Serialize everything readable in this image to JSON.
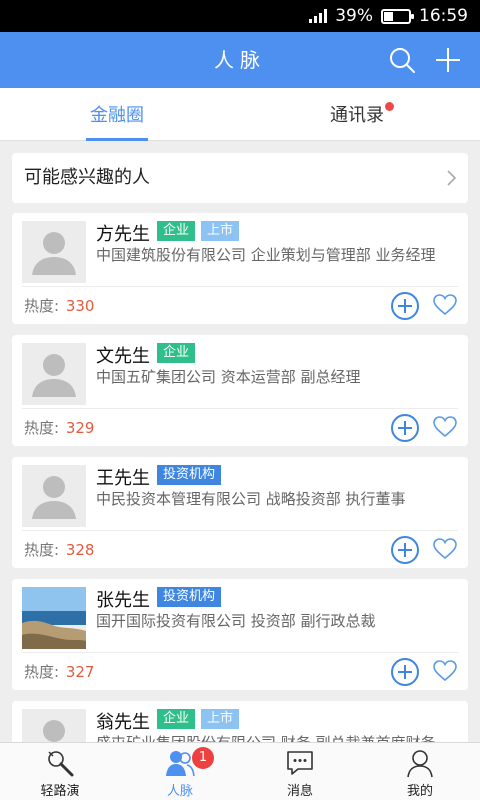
{
  "status_bar": {
    "battery": "39%",
    "battery_level": 0.39,
    "time": "16:59"
  },
  "app_bar": {
    "title": "人脉"
  },
  "tabs": [
    {
      "label": "金融圈",
      "active": true
    },
    {
      "label": "通讯录",
      "has_dot": true
    }
  ],
  "interest_row": {
    "label": "可能感兴趣的人"
  },
  "heat_label": "热度:",
  "tag_labels": {
    "company": "企业",
    "listed": "上市",
    "invest": "投资机构"
  },
  "people": [
    {
      "name": "方先生",
      "description": "中国建筑股份有限公司 企业策划与管理部 业务经理",
      "heat": "330"
    },
    {
      "name": "文先生",
      "description": "中国五矿集团公司 资本运营部 副总经理",
      "heat": "329"
    },
    {
      "name": "王先生",
      "description": "中民投资本管理有限公司 战略投资部 执行董事",
      "heat": "328"
    },
    {
      "name": "张先生",
      "description": "国开国际投资有限公司 投资部 副行政总裁",
      "heat": "327"
    },
    {
      "name": "翁先生",
      "description": "盛屯矿业集团股份有限公司 财务 副总裁兼首席财务",
      "heat": ""
    }
  ],
  "bottom_nav": [
    {
      "label": "轻路演",
      "icon": "flashlight-icon"
    },
    {
      "label": "人脉",
      "icon": "people-icon",
      "active": true,
      "badge": "1"
    },
    {
      "label": "消息",
      "icon": "chat-icon"
    },
    {
      "label": "我的",
      "icon": "person-icon"
    }
  ],
  "colors": {
    "accent": "#4d90ef",
    "heat": "#e25b3e",
    "tag_company": "#2fbf8a",
    "tag_listed": "#8cc3f3",
    "tag_invest": "#3f86e0",
    "badge": "#ef4040"
  }
}
